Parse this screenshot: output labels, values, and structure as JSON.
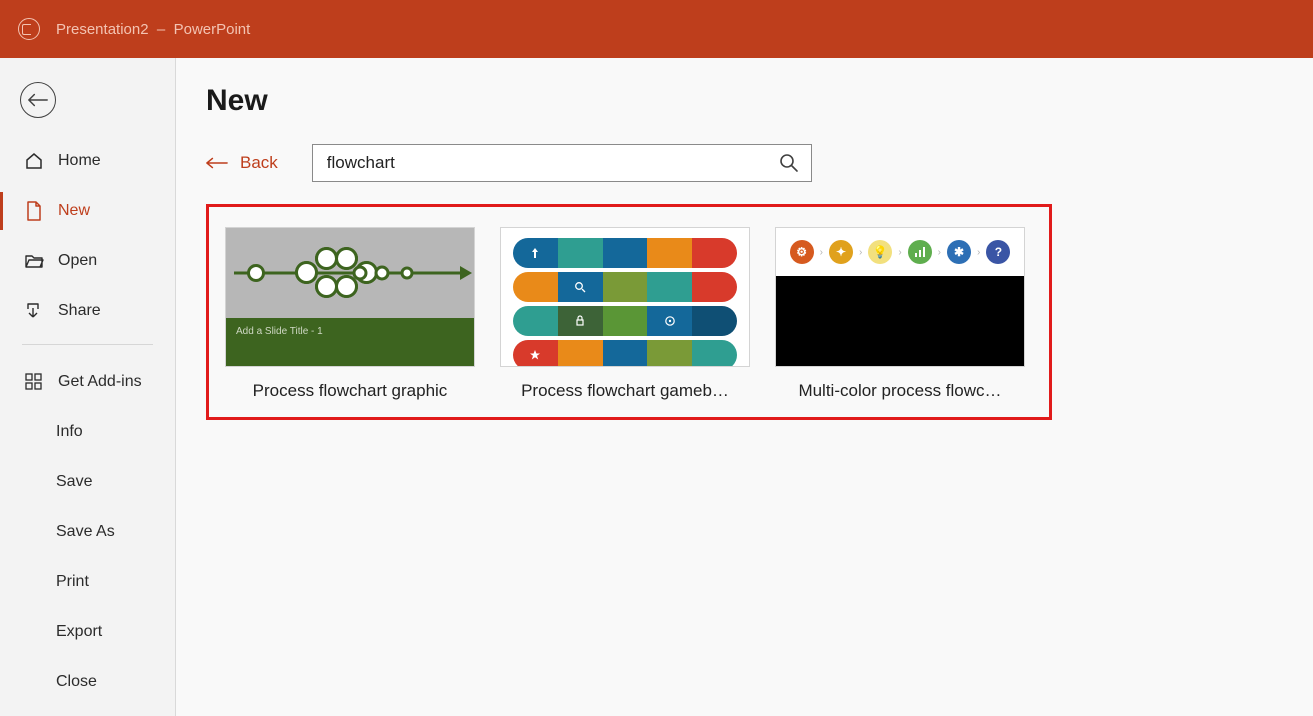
{
  "titlebar": {
    "doc_title": "Presentation2",
    "sep": "  –  ",
    "app_name": "PowerPoint"
  },
  "sidebar": {
    "home": "Home",
    "new": "New",
    "open": "Open",
    "share": "Share",
    "getaddins": "Get Add-ins",
    "info": "Info",
    "save": "Save",
    "saveas": "Save As",
    "print": "Print",
    "export": "Export",
    "close": "Close"
  },
  "main": {
    "page_title": "New",
    "back_label": "Back",
    "search_value": "flowchart"
  },
  "templates": {
    "t1": {
      "label": "Process flowchart graphic",
      "slide_hint": "Add a Slide Title - 1"
    },
    "t2": {
      "label": "Process flowchart gameb…"
    },
    "t3": {
      "label": "Multi-color process flowc…"
    }
  }
}
